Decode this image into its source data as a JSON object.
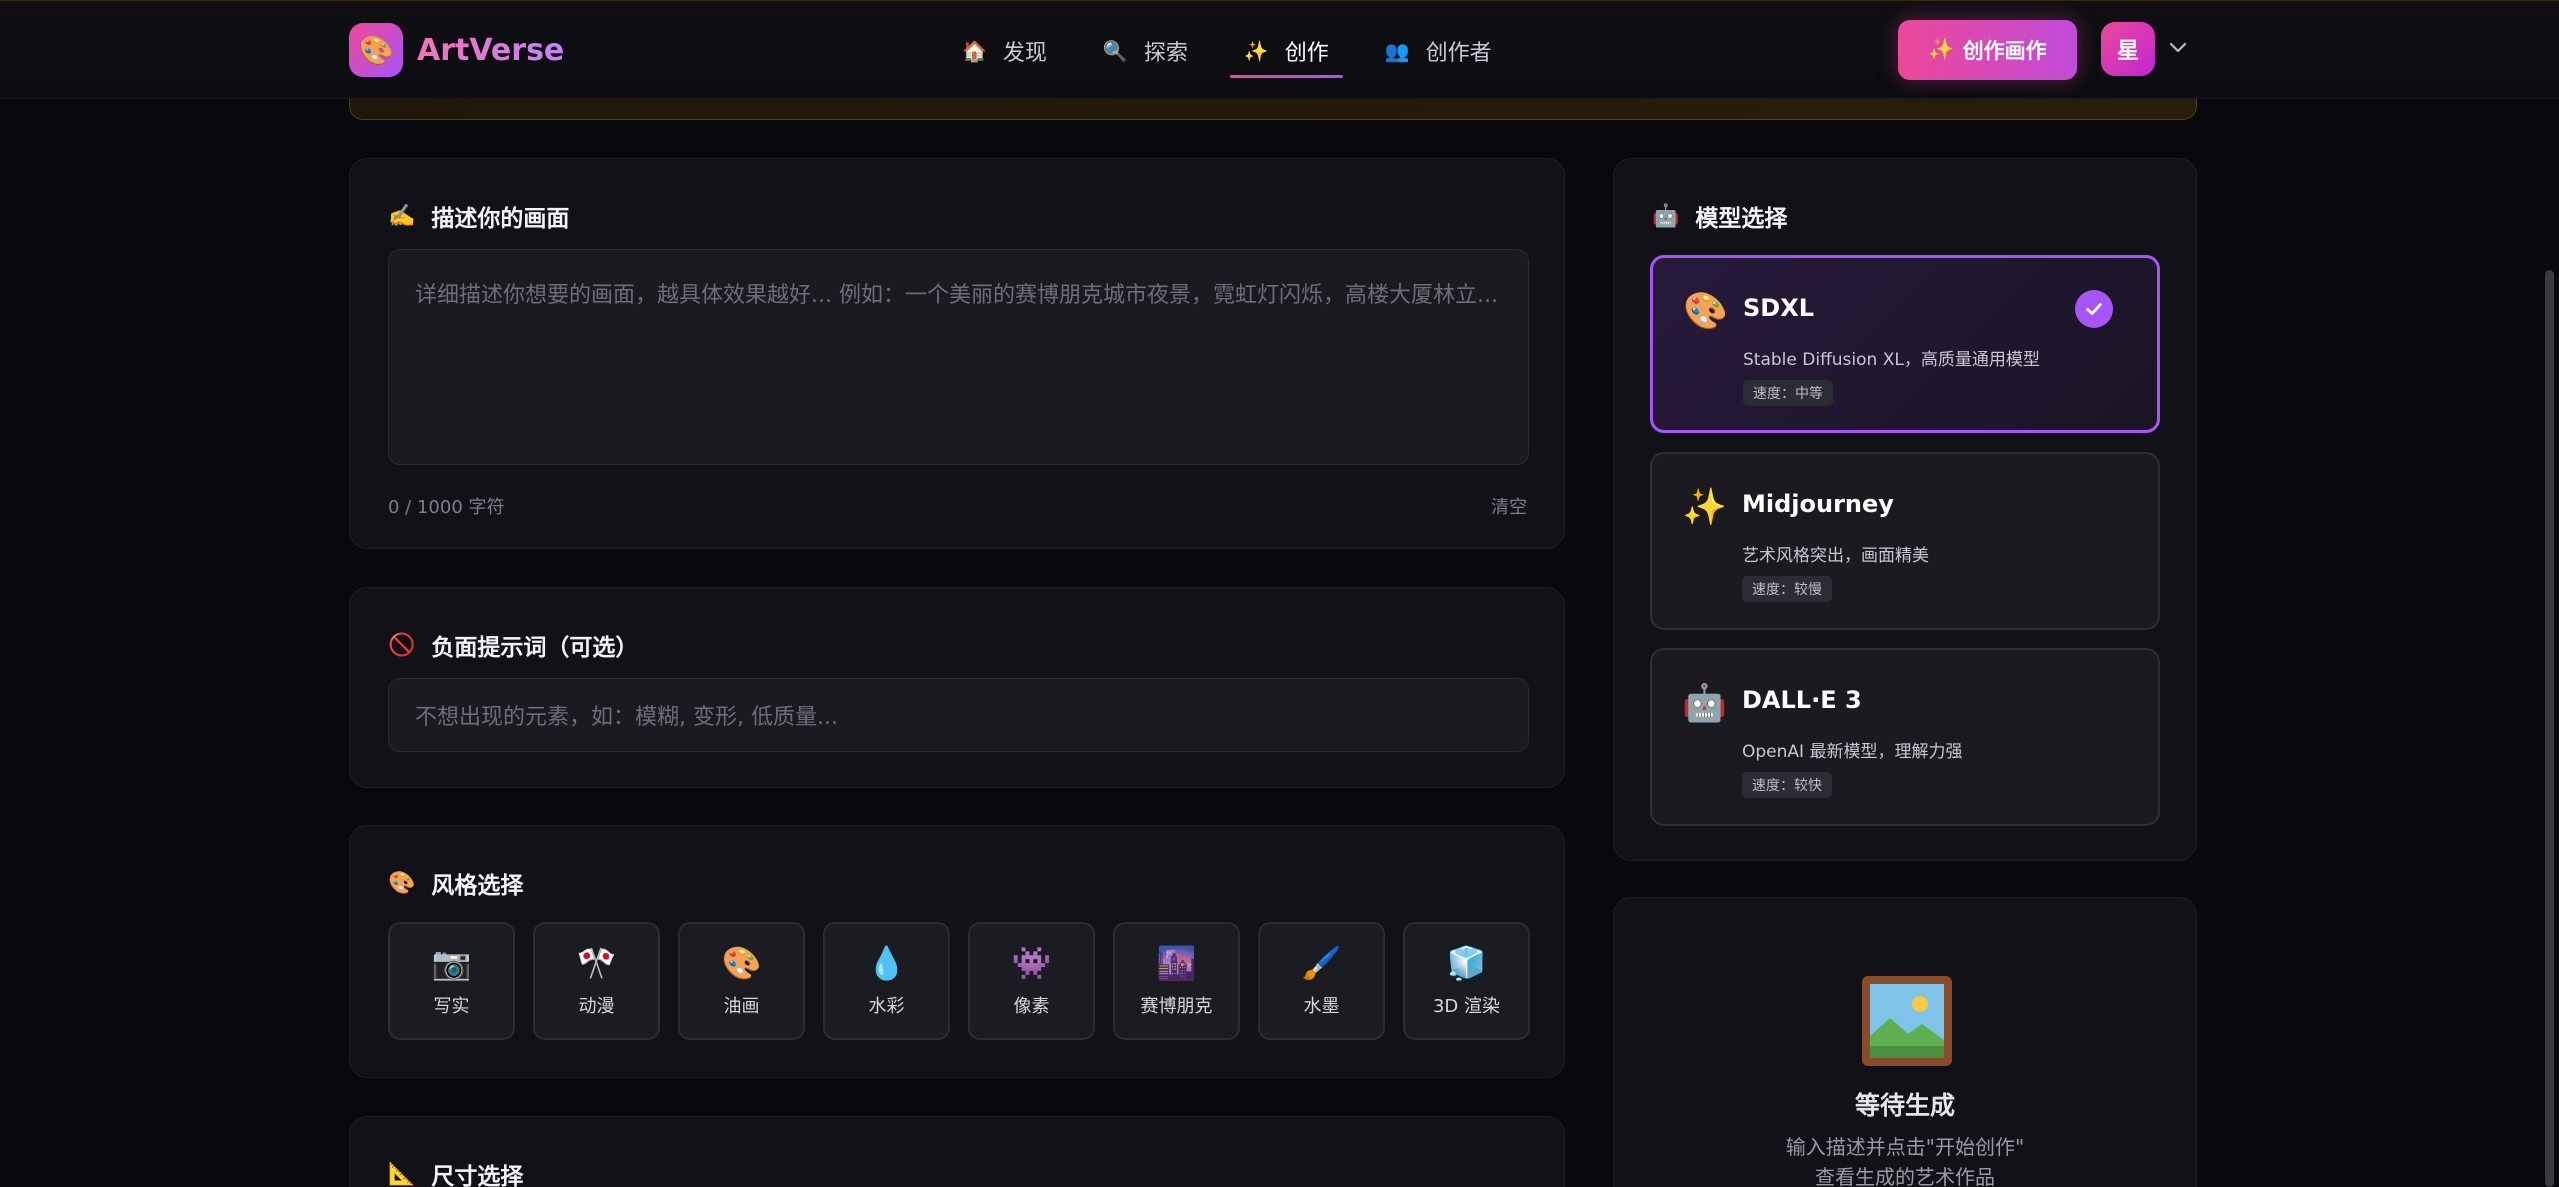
{
  "brand": {
    "name": "ArtVerse",
    "logo_icon": "🎨"
  },
  "nav": {
    "items": [
      {
        "icon": "🏠",
        "label": "发现"
      },
      {
        "icon": "🔍",
        "label": "探索"
      },
      {
        "icon": "✨",
        "label": "创作"
      },
      {
        "icon": "👥",
        "label": "创作者"
      }
    ],
    "active": "创作"
  },
  "header": {
    "create_button": {
      "icon": "✨",
      "label": "创作画作"
    },
    "avatar_initial": "星"
  },
  "prompt": {
    "icon": "✍️",
    "title": "描述你的画面",
    "placeholder": "详细描述你想要的画面，越具体效果越好... 例如：一个美丽的赛博朋克城市夜景，霓虹灯闪烁，高楼大厦林立...",
    "counter": "0 / 1000 字符",
    "clear_label": "清空"
  },
  "negative": {
    "icon": "🚫",
    "title": "负面提示词（可选）",
    "placeholder": "不想出现的元素，如：模糊, 变形, 低质量..."
  },
  "styles": {
    "icon": "🎨",
    "title": "风格选择",
    "items": [
      {
        "icon": "📷",
        "label": "写实"
      },
      {
        "icon": "🎌",
        "label": "动漫"
      },
      {
        "icon": "🎨",
        "label": "油画"
      },
      {
        "icon": "💧",
        "label": "水彩"
      },
      {
        "icon": "👾",
        "label": "像素"
      },
      {
        "icon": "🌆",
        "label": "赛博朋克"
      },
      {
        "icon": "🖌️",
        "label": "水墨"
      },
      {
        "icon": "🧊",
        "label": "3D 渲染"
      }
    ]
  },
  "size": {
    "icon": "📐",
    "title": "尺寸选择"
  },
  "models": {
    "icon": "🤖",
    "title": "模型选择",
    "selected": "SDXL",
    "items": [
      {
        "icon": "🎨",
        "name": "SDXL",
        "desc": "Stable Diffusion XL，高质量通用模型",
        "speed": "速度：中等"
      },
      {
        "icon": "✨",
        "name": "Midjourney",
        "desc": "艺术风格突出，画面精美",
        "speed": "速度：较慢"
      },
      {
        "icon": "🤖",
        "name": "DALL·E 3",
        "desc": "OpenAI 最新模型，理解力强",
        "speed": "速度：较快"
      }
    ]
  },
  "preview": {
    "title": "等待生成",
    "hint_line1": "输入描述并点击\"开始创作\"",
    "hint_line2": "查看生成的艺术作品"
  },
  "colors": {
    "accent_pink": "#ec4899",
    "accent_purple": "#a855f7",
    "background": "#09090d",
    "card": "#111117"
  }
}
